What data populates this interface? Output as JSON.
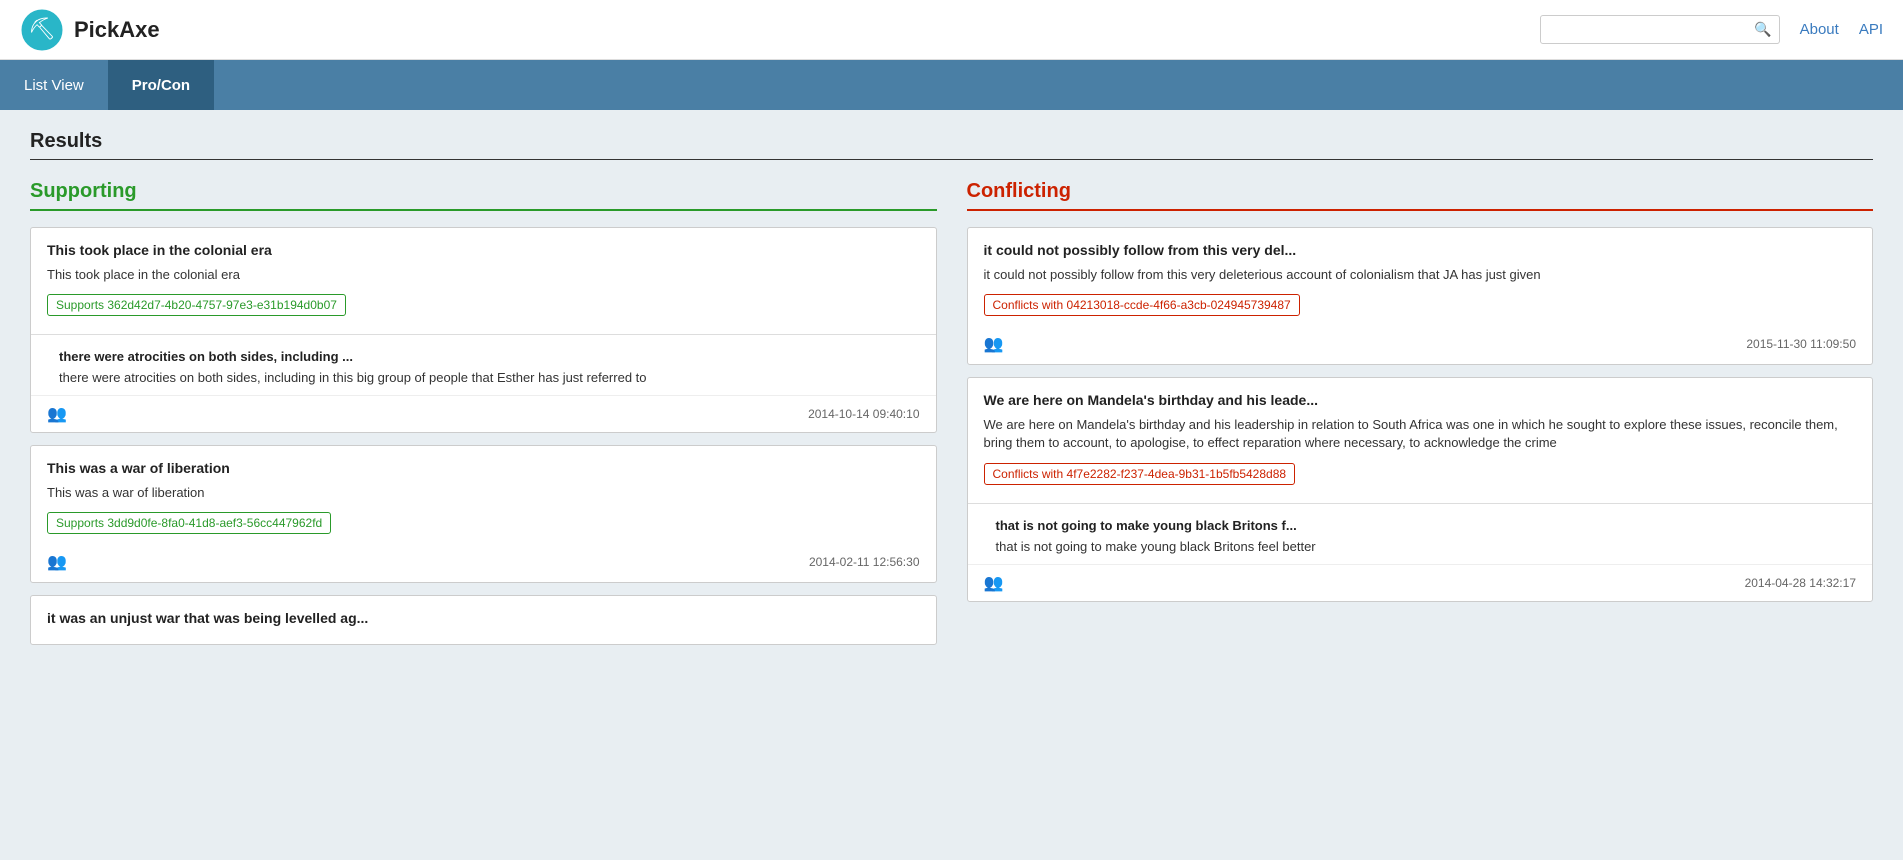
{
  "header": {
    "logo_text": "PickAxe",
    "search_placeholder": "",
    "nav_about": "About",
    "nav_api": "API"
  },
  "navbar": {
    "list_view": "List View",
    "pro_con": "Pro/Con"
  },
  "main": {
    "results_title": "Results",
    "supporting_header": "Supporting",
    "conflicting_header": "Conflicting",
    "supporting_cards": [
      {
        "title": "This took place in the colonial era",
        "body": "This took place in the colonial era",
        "tag": "Supports 362d42d7-4b20-4757-97e3-e31b194d0b07",
        "has_second": true,
        "second_title": "there were atrocities on both sides, including ...",
        "second_body": "there were atrocities on both sides, including in this big group of people that Esther has just referred to",
        "timestamp": "2014-10-14 09:40:10"
      },
      {
        "title": "This was a war of liberation",
        "body": "This was a war of liberation",
        "tag": "Supports 3dd9d0fe-8fa0-41d8-aef3-56cc447962fd",
        "has_second": false,
        "timestamp": "2014-02-11 12:56:30"
      },
      {
        "title": "it was an unjust war that was being levelled ag...",
        "body": "",
        "tag": "",
        "has_second": false,
        "timestamp": ""
      }
    ],
    "conflicting_cards": [
      {
        "title": "it could not possibly follow from this very del...",
        "body": "it could not possibly follow from this very deleterious account of colonialism that JA has just given",
        "tag": "Conflicts with 04213018-ccde-4f66-a3cb-024945739487",
        "timestamp": "2015-11-30 11:09:50"
      },
      {
        "title": "We are here on Mandela's birthday and his leade...",
        "body": "We are here on Mandela's birthday and his leadership in relation to South Africa was one in which he sought to explore these issues, reconcile them, bring them to account, to apologise, to effect reparation where necessary, to acknowledge the crime",
        "tag": "Conflicts with 4f7e2282-f237-4dea-9b31-1b5fb5428d88",
        "has_second": true,
        "second_title": "that is not going to make young black Britons f...",
        "second_body": "that is not going to make young black Britons feel better",
        "timestamp": "2014-04-28 14:32:17"
      }
    ]
  }
}
